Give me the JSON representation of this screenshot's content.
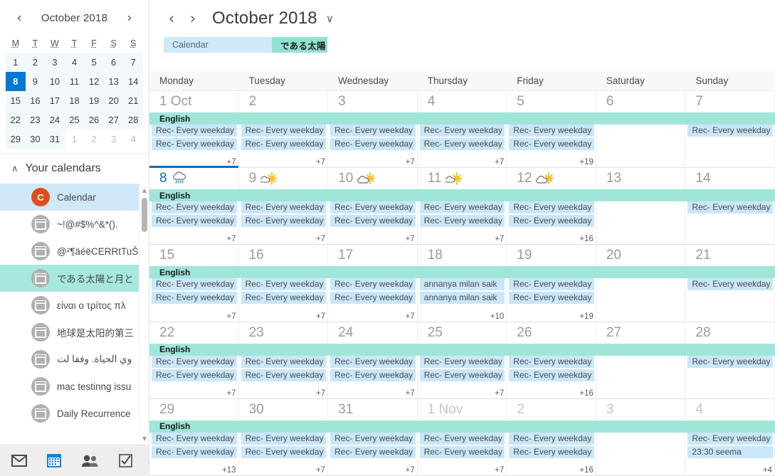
{
  "sidebar": {
    "mini_calendar": {
      "title": "October 2018",
      "prev_label": "‹",
      "next_label": "›",
      "dow": [
        "M",
        "T",
        "W",
        "T",
        "F",
        "S",
        "S"
      ],
      "selected_day": 8,
      "weeks": [
        [
          {
            "d": "1"
          },
          {
            "d": "2"
          },
          {
            "d": "3"
          },
          {
            "d": "4"
          },
          {
            "d": "5"
          },
          {
            "d": "6"
          },
          {
            "d": "7"
          }
        ],
        [
          {
            "d": "8",
            "sel": true
          },
          {
            "d": "9"
          },
          {
            "d": "10"
          },
          {
            "d": "11"
          },
          {
            "d": "12"
          },
          {
            "d": "13"
          },
          {
            "d": "14"
          }
        ],
        [
          {
            "d": "15"
          },
          {
            "d": "16"
          },
          {
            "d": "17"
          },
          {
            "d": "18"
          },
          {
            "d": "19"
          },
          {
            "d": "20"
          },
          {
            "d": "21"
          }
        ],
        [
          {
            "d": "22"
          },
          {
            "d": "23"
          },
          {
            "d": "24"
          },
          {
            "d": "25"
          },
          {
            "d": "26"
          },
          {
            "d": "27"
          },
          {
            "d": "28"
          }
        ],
        [
          {
            "d": "29"
          },
          {
            "d": "30"
          },
          {
            "d": "31"
          },
          {
            "d": "1",
            "other": true
          },
          {
            "d": "2",
            "other": true
          },
          {
            "d": "3",
            "other": true
          },
          {
            "d": "4",
            "other": true
          }
        ]
      ]
    },
    "section_title": "Your calendars",
    "collapse_icon": "∧",
    "calendars": [
      {
        "label": "Calendar",
        "avatar": "C",
        "avatar_kind": "letter",
        "state": "selected-blue"
      },
      {
        "label": "~!@#$%^&*().",
        "avatar_kind": "calendar-icon",
        "state": "none"
      },
      {
        "label": "@²¶äéëCERRtTuŠ",
        "avatar_kind": "calendar-icon",
        "state": "none"
      },
      {
        "label": "である太陽と月と",
        "avatar_kind": "calendar-icon",
        "state": "selected-teal"
      },
      {
        "label": "είναι ο τρίτος πλ",
        "avatar_kind": "calendar-icon",
        "state": "none"
      },
      {
        "label": "地球是太阳的第三",
        "avatar_kind": "calendar-icon",
        "state": "none"
      },
      {
        "label": "وي الحياة. وفقا لت",
        "avatar_kind": "calendar-icon",
        "state": "none"
      },
      {
        "label": "mac testinng issu",
        "avatar_kind": "calendar-icon",
        "state": "none"
      },
      {
        "label": "Daily Recurrence",
        "avatar_kind": "calendar-icon",
        "state": "none"
      }
    ],
    "bottom_nav": [
      {
        "name": "mail",
        "active": false
      },
      {
        "name": "calendar",
        "active": true
      },
      {
        "name": "people",
        "active": false
      },
      {
        "name": "tasks",
        "active": false
      }
    ]
  },
  "main": {
    "prev_label": "‹",
    "next_label": "›",
    "title": "October 2018",
    "caret": "∨",
    "calendar_tabs": [
      {
        "label": "Calendar",
        "style": "blue"
      },
      {
        "label": "である太陽と月と相",
        "style": "teal"
      }
    ],
    "day_headers": [
      "Monday",
      "Tuesday",
      "Wednesday",
      "Thursday",
      "Friday",
      "Saturday",
      "Sunday"
    ],
    "allday_label": "English",
    "weeks": [
      {
        "allday": "English",
        "days": [
          {
            "num": "1 Oct",
            "events": [
              "Rec- Every weekday",
              "Rec- Every weekday"
            ],
            "more": "+7"
          },
          {
            "num": "2",
            "events": [
              "Rec- Every weekday",
              "Rec- Every weekday"
            ],
            "more": "+7"
          },
          {
            "num": "3",
            "events": [
              "Rec- Every weekday",
              "Rec- Every weekday"
            ],
            "more": "+7"
          },
          {
            "num": "4",
            "events": [
              "Rec- Every weekday",
              "Rec- Every weekday"
            ],
            "more": "+7"
          },
          {
            "num": "5",
            "events": [
              "Rec- Every weekday",
              "Rec- Every weekday"
            ],
            "more": "+19"
          },
          {
            "num": "6",
            "events": [],
            "more": ""
          },
          {
            "num": "7",
            "events": [
              "Rec- Every weekday"
            ],
            "more": ""
          }
        ]
      },
      {
        "allday": "English",
        "days": [
          {
            "num": "8",
            "weather": "rain",
            "today": true,
            "events": [
              "Rec- Every weekday",
              "Rec- Every weekday"
            ],
            "more": "+7"
          },
          {
            "num": "9",
            "weather": "sun",
            "events": [
              "Rec- Every weekday",
              "Rec- Every weekday"
            ],
            "more": "+7"
          },
          {
            "num": "10",
            "weather": "partly",
            "events": [
              "Rec- Every weekday",
              "Rec- Every weekday"
            ],
            "more": "+7"
          },
          {
            "num": "11",
            "weather": "sun",
            "events": [
              "Rec- Every weekday",
              "Rec- Every weekday"
            ],
            "more": "+7"
          },
          {
            "num": "12",
            "weather": "partly",
            "events": [
              "Rec- Every weekday",
              "Rec- Every weekday"
            ],
            "more": "+16"
          },
          {
            "num": "13",
            "events": [],
            "more": ""
          },
          {
            "num": "14",
            "events": [
              "Rec- Every weekday"
            ],
            "more": ""
          }
        ]
      },
      {
        "allday": "English",
        "days": [
          {
            "num": "15",
            "events": [
              "Rec- Every weekday",
              "Rec- Every weekday"
            ],
            "more": "+7"
          },
          {
            "num": "16",
            "events": [
              "Rec- Every weekday",
              "Rec- Every weekday"
            ],
            "more": "+7"
          },
          {
            "num": "17",
            "events": [
              "Rec- Every weekday",
              "Rec- Every weekday"
            ],
            "more": "+7"
          },
          {
            "num": "18",
            "events": [
              "annanya milan saik",
              "annanya milan saik"
            ],
            "more": "+10"
          },
          {
            "num": "19",
            "events": [
              "Rec- Every weekday",
              "Rec- Every weekday"
            ],
            "more": "+19"
          },
          {
            "num": "20",
            "events": [],
            "more": ""
          },
          {
            "num": "21",
            "events": [
              "Rec- Every weekday"
            ],
            "more": ""
          }
        ]
      },
      {
        "allday": "English",
        "days": [
          {
            "num": "22",
            "events": [
              "Rec- Every weekday",
              "Rec- Every weekday"
            ],
            "more": "+7"
          },
          {
            "num": "23",
            "events": [
              "Rec- Every weekday",
              "Rec- Every weekday"
            ],
            "more": "+7"
          },
          {
            "num": "24",
            "events": [
              "Rec- Every weekday",
              "Rec- Every weekday"
            ],
            "more": "+7"
          },
          {
            "num": "25",
            "events": [
              "Rec- Every weekday",
              "Rec- Every weekday"
            ],
            "more": "+7"
          },
          {
            "num": "26",
            "events": [
              "Rec- Every weekday",
              "Rec- Every weekday"
            ],
            "more": "+16"
          },
          {
            "num": "27",
            "events": [],
            "more": ""
          },
          {
            "num": "28",
            "events": [
              "Rec- Every weekday"
            ],
            "more": ""
          }
        ]
      },
      {
        "allday": "English",
        "days": [
          {
            "num": "29",
            "events": [
              "Rec- Every weekday",
              "Rec- Every weekday"
            ],
            "more": "+13"
          },
          {
            "num": "30",
            "events": [
              "Rec- Every weekday",
              "Rec- Every weekday"
            ],
            "more": "+7"
          },
          {
            "num": "31",
            "events": [
              "Rec- Every weekday",
              "Rec- Every weekday"
            ],
            "more": "+7"
          },
          {
            "num": "1 Nov",
            "other": true,
            "events": [
              "Rec- Every weekday",
              "Rec- Every weekday"
            ],
            "more": "+7"
          },
          {
            "num": "2",
            "other": true,
            "events": [
              "Rec- Every weekday",
              "Rec- Every weekday"
            ],
            "more": "+16"
          },
          {
            "num": "3",
            "other": true,
            "events": [],
            "more": ""
          },
          {
            "num": "4",
            "other": true,
            "events": [
              "Rec- Every weekday",
              "23:30 seema"
            ],
            "more": "+4"
          }
        ]
      }
    ]
  },
  "colors": {
    "accent_blue": "#0078d4",
    "today_blue": "#0f6cbd",
    "event_blue": "#c9e7f9",
    "allday_teal": "#9fe6d9",
    "selected_teal": "#a6e8dd",
    "selected_blue": "#cfe9f8",
    "avatar_orange": "#e04e1b"
  }
}
